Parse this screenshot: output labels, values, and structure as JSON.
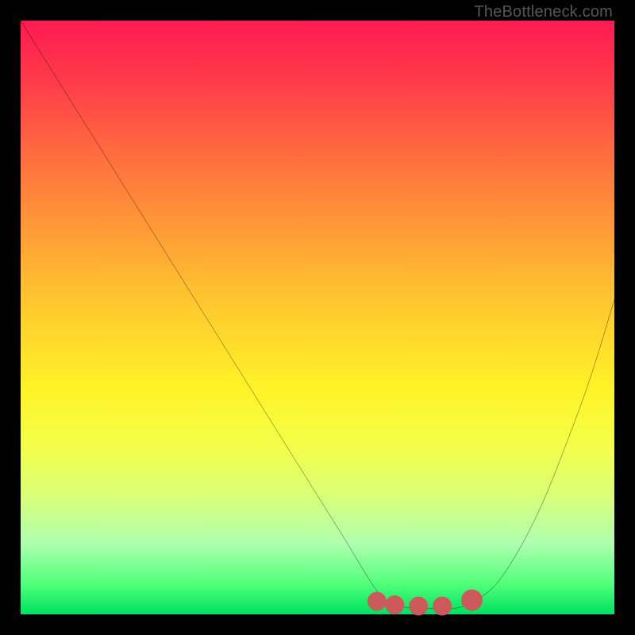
{
  "watermark": "TheBottleneck.com",
  "chart_data": {
    "type": "line",
    "title": "",
    "xlabel": "",
    "ylabel": "",
    "xlim": [
      0,
      100
    ],
    "ylim": [
      0,
      100
    ],
    "grid": false,
    "series": [
      {
        "name": "bottleneck-curve",
        "color": "#000000",
        "x": [
          0,
          5,
          10,
          15,
          20,
          25,
          30,
          35,
          40,
          45,
          50,
          55,
          58,
          60,
          62,
          66,
          70,
          73,
          76,
          80,
          84,
          88,
          92,
          96,
          100
        ],
        "y": [
          100,
          92,
          84,
          76,
          68,
          60,
          52,
          44,
          36,
          28,
          20,
          12,
          7,
          4,
          2,
          1,
          1,
          1,
          2,
          5,
          11,
          19,
          29,
          40,
          53
        ]
      }
    ],
    "markers": [
      {
        "name": "optimal-range-left",
        "x": 60,
        "y": 2.2,
        "color": "#cc5a5a",
        "r": 1.6
      },
      {
        "name": "optimal-range-mid1",
        "x": 63,
        "y": 1.6,
        "color": "#cc5a5a",
        "r": 1.6
      },
      {
        "name": "optimal-range-mid2",
        "x": 67,
        "y": 1.4,
        "color": "#cc5a5a",
        "r": 1.6
      },
      {
        "name": "optimal-range-mid3",
        "x": 71,
        "y": 1.4,
        "color": "#cc5a5a",
        "r": 1.6
      },
      {
        "name": "optimal-range-right",
        "x": 76,
        "y": 2.4,
        "color": "#cc5a5a",
        "r": 1.8
      }
    ]
  }
}
